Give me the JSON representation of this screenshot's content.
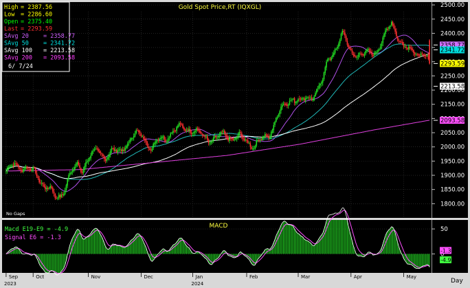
{
  "chart_data": {
    "type": "candlestick",
    "title": "Gold  Spot  Price,RT  (IQXGL)",
    "info_box": [
      {
        "label": "High",
        "value": "2387.56",
        "color": "#ffff00"
      },
      {
        "label": "Low",
        "value": "2286.60",
        "color": "#ffff00"
      },
      {
        "label": "Open",
        "value": "2375.40",
        "color": "#00ff00"
      },
      {
        "label": "Last",
        "value": "2293.59",
        "color": "#ff3030"
      },
      {
        "label": "SAvg  20",
        "value": "2358.77",
        "color": "#d060ff"
      },
      {
        "label": "SAvg  50",
        "value": "2341.72",
        "color": "#00e0e0"
      },
      {
        "label": "SAvg  100",
        "value": "2213.58",
        "color": "#ffffff"
      },
      {
        "label": "SAvg  200",
        "value": "2093.58",
        "color": "#ff40ff"
      }
    ],
    "date_label": "6/  7/24",
    "no_gaps_label": "No Gaps",
    "y_axis": {
      "min": 1750,
      "max": 2510,
      "ticks": [
        "2500.00",
        "2450.00",
        "2400.00",
        "2350.00",
        "2300.00",
        "2250.00",
        "2200.00",
        "2150.00",
        "2100.00",
        "2050.00",
        "2000.00",
        "1950.00",
        "1900.00",
        "1850.00",
        "1800.00"
      ]
    },
    "x_axis": {
      "months": [
        "Sep",
        "Oct",
        "Nov",
        "Dec",
        "Jan",
        "Feb",
        "Mar",
        "Apr",
        "May"
      ],
      "years": [
        "2023",
        "2024"
      ],
      "unit_label": "Day"
    },
    "price_tags": [
      {
        "value": "2358.77",
        "color": "#d070ff"
      },
      {
        "value": "2341.72",
        "color": "#00dede"
      },
      {
        "value": "2293.59",
        "color": "#ffff00"
      },
      {
        "value": "2213.58",
        "color": "#ffffff"
      },
      {
        "value": "2093.58",
        "color": "#ff50ff"
      }
    ],
    "price_anchors": [
      [
        0,
        1915
      ],
      [
        6,
        1935
      ],
      [
        14,
        1930
      ],
      [
        20,
        1918
      ],
      [
        24,
        1905
      ],
      [
        30,
        1870
      ],
      [
        36,
        1850
      ],
      [
        40,
        1820
      ],
      [
        44,
        1825
      ],
      [
        48,
        1860
      ],
      [
        52,
        1905
      ],
      [
        58,
        1935
      ],
      [
        62,
        1920
      ],
      [
        68,
        1970
      ],
      [
        74,
        1985
      ],
      [
        80,
        1965
      ],
      [
        86,
        1985
      ],
      [
        92,
        1980
      ],
      [
        98,
        2010
      ],
      [
        104,
        2040
      ],
      [
        110,
        2045
      ],
      [
        114,
        2025
      ],
      [
        118,
        1990
      ],
      [
        124,
        2025
      ],
      [
        130,
        2035
      ],
      [
        136,
        2055
      ],
      [
        142,
        2070
      ],
      [
        148,
        2065
      ],
      [
        154,
        2055
      ],
      [
        160,
        2040
      ],
      [
        166,
        2025
      ],
      [
        172,
        2030
      ],
      [
        178,
        2045
      ],
      [
        184,
        2030
      ],
      [
        190,
        2035
      ],
      [
        196,
        2020
      ],
      [
        202,
        2005
      ],
      [
        208,
        2025
      ],
      [
        214,
        2040
      ],
      [
        218,
        2080
      ],
      [
        222,
        2120
      ],
      [
        228,
        2150
      ],
      [
        234,
        2175
      ],
      [
        240,
        2160
      ],
      [
        246,
        2170
      ],
      [
        252,
        2190
      ],
      [
        258,
        2235
      ],
      [
        262,
        2305
      ],
      [
        266,
        2330
      ],
      [
        270,
        2360
      ],
      [
        274,
        2400
      ],
      [
        280,
        2340
      ],
      [
        286,
        2325
      ],
      [
        292,
        2325
      ],
      [
        296,
        2330
      ],
      [
        302,
        2340
      ],
      [
        308,
        2385
      ],
      [
        314,
        2440
      ],
      [
        318,
        2400
      ],
      [
        324,
        2350
      ],
      [
        330,
        2340
      ],
      [
        336,
        2330
      ],
      [
        340,
        2325
      ],
      [
        345,
        2293
      ]
    ],
    "moving_averages": [
      {
        "name": "SAvg 20",
        "color": "#b050e8",
        "period": 20
      },
      {
        "name": "SAvg 50",
        "color": "#20b8b8",
        "period": 50
      },
      {
        "name": "SAvg 100",
        "color": "#ffffff",
        "period": 100
      },
      {
        "name": "SAvg 200",
        "color": "#e040e0",
        "points": [
          [
            0,
            1915
          ],
          [
            60,
            1920
          ],
          [
            120,
            1945
          ],
          [
            180,
            1970
          ],
          [
            240,
            2010
          ],
          [
            300,
            2060
          ],
          [
            345,
            2094
          ]
        ]
      }
    ],
    "macd": {
      "title": "MACD",
      "macd_label": "Macd  E19-E9  =  -4.9",
      "signal_label": "Signal  E6  =  -1.3",
      "y_range": [
        -38,
        68
      ],
      "ticks": [
        "50",
        "0"
      ],
      "tags": [
        {
          "value": "-1.3",
          "color": "#ff50ff"
        },
        {
          "value": "-4.9",
          "color": "#40ff40"
        }
      ]
    }
  }
}
